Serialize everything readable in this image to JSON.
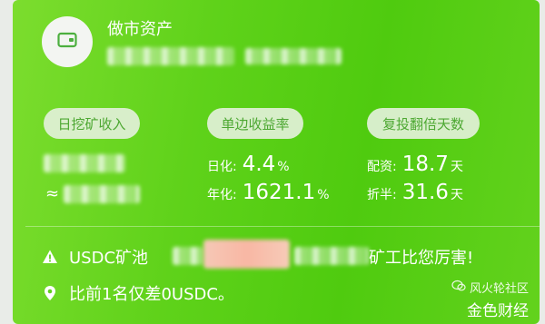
{
  "header": {
    "title": "做市资产"
  },
  "pills": {
    "daily_mining": "日挖矿收入",
    "one_side_yield": "单边收益率",
    "reinvest_double": "复投翻倍天数"
  },
  "left": {
    "approx_symbol": "≈"
  },
  "yield": {
    "daily_label": "日化:",
    "daily_value": "4.4",
    "daily_unit": "%",
    "annual_label": "年化:",
    "annual_value": "1621.1",
    "annual_unit": "%"
  },
  "days": {
    "alloc_label": "配资:",
    "alloc_value": "18.7",
    "alloc_unit": "天",
    "half_label": "折半:",
    "half_value": "31.6",
    "half_unit": "天"
  },
  "notices": {
    "pool_prefix": "USDC矿池",
    "pool_suffix": "矿工比您厉害!",
    "rank_text": "比前1名仅差0USDC。"
  },
  "watermark": {
    "line1": "风火轮社区",
    "line2": "金色财经"
  },
  "colors": {
    "card_green": "#5fd21a",
    "pill_text": "#4da832"
  },
  "icons": {
    "wallet": "wallet-icon",
    "warning": "warning-icon",
    "location": "location-pin-icon"
  }
}
